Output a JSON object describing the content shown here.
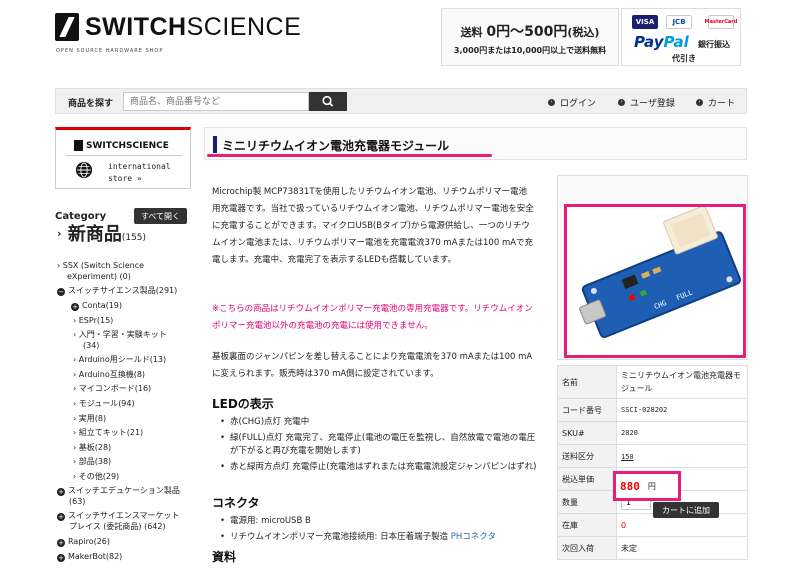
{
  "header": {
    "logo_main": "SWITCH",
    "logo_thin": "SCIENCE",
    "logo_sub": "OPEN SOURCE HARDWARE SHOP",
    "shipping_main_prefix": "送料",
    "shipping_main_range": "0円～500円",
    "shipping_main_suffix": "(税込)",
    "shipping_sub": "3,000円または10,000円以上で送料無料",
    "cards": [
      "VISA",
      "JCB",
      "MasterCard"
    ],
    "paypal_a": "Pay",
    "paypal_b": "Pal",
    "bank": "銀行振込",
    "cod": "代引き"
  },
  "search": {
    "label": "商品を探す",
    "placeholder": "商品名、商品番号など",
    "login": "ログイン",
    "register": "ユーザ登録",
    "cart": "カート"
  },
  "sidebar": {
    "banner_logo": "SWITCHSCIENCE",
    "banner_line1": "international",
    "banner_line2": "store  »",
    "category_title": "Category",
    "open_all": "すべて開く",
    "new_label": "新商品",
    "new_count": "(155)",
    "items": [
      "SSX (Switch Science",
      "eXperiment) (0)",
      "スイッチサイエンス製品(291)",
      "Conta(19)",
      "ESPr(15)",
      "入門・学習・実験キット",
      "(34)",
      "Arduino用シールド(13)",
      "Arduino互換機(8)",
      "マイコンボード(16)",
      "モジュール(94)",
      "実用(8)",
      "組立てキット(21)",
      "基板(28)",
      "部品(38)",
      "その他(29)",
      "スイッチエデュケーション製品",
      "(63)",
      "スイッチサイエンスマーケット",
      "プレイス (委託商品) (642)",
      "Rapiro(26)",
      "MakerBot(82)"
    ]
  },
  "product": {
    "title": "ミニリチウムイオン電池充電器モジュール",
    "desc": "Microchip製 MCP73831Tを使用したリチウムイオン電池、リチウムポリマー電池用充電器です。当社で扱っているリチウムイオン電池、リチウムポリマー電池を安全に充電することができます。マイクロUSB(Bタイプ)から電源供給し、一つのリチウムイオン電池または、リチウムポリマー電池を充電電流370 mAまたは100 mAで充電します。充電中、充電完了を表示するLEDも搭載しています。",
    "notice": "※こちらの商品はリチウムイオンポリマー充電池の専用充電器です。リチウムイオンポリマー充電池以外の充電池の充電には使用できません。",
    "desc2": "基板裏面のジャンパピンを差し替えることにより充電電流を370 mAまたは100 mAに変えられます。販売時は370 mA側に設定されています。",
    "led_heading": "LEDの表示",
    "led_items": [
      "赤(CHG)点灯 充電中",
      "緑(FULL)点灯 充電完了、充電停止(電池の電圧を監視し、自然放電で電池の電圧が下がると再び充電を開始します)",
      "赤と緑両方点灯 充電停止(充電池はずれまたは充電電流設定ジャンパピンはずれ)"
    ],
    "conn_heading": "コネクタ",
    "conn_items": [
      "電源用: microUSB B",
      "リチウムイオンポリマー充電池接続用: 日本圧着端子製造 "
    ],
    "conn_link": "PHコネクタ",
    "doc_heading": "資料"
  },
  "spec": {
    "rows": [
      {
        "k": "名前",
        "v": "ミニリチウムイオン電池充電器モジュール"
      },
      {
        "k": "コード番号",
        "v": "SSCI-028202"
      },
      {
        "k": "SKU#",
        "v": "2820"
      },
      {
        "k": "送料区分",
        "v": "150"
      },
      {
        "k": "税込単価",
        "v": ""
      },
      {
        "k": "数量",
        "v": ""
      },
      {
        "k": "在庫",
        "v": "0"
      },
      {
        "k": "次回入荷",
        "v": "未定"
      }
    ],
    "price": "880",
    "price_unit": "円",
    "qty": "1",
    "add_cart": "カートに追加",
    "board_labels": [
      "CHG",
      "FULL"
    ]
  },
  "colors": {
    "highlight": "#e91e7a",
    "title_bar": "#1a1a80",
    "board_blue": "#1e5fb4",
    "price_red": "#e00000"
  }
}
